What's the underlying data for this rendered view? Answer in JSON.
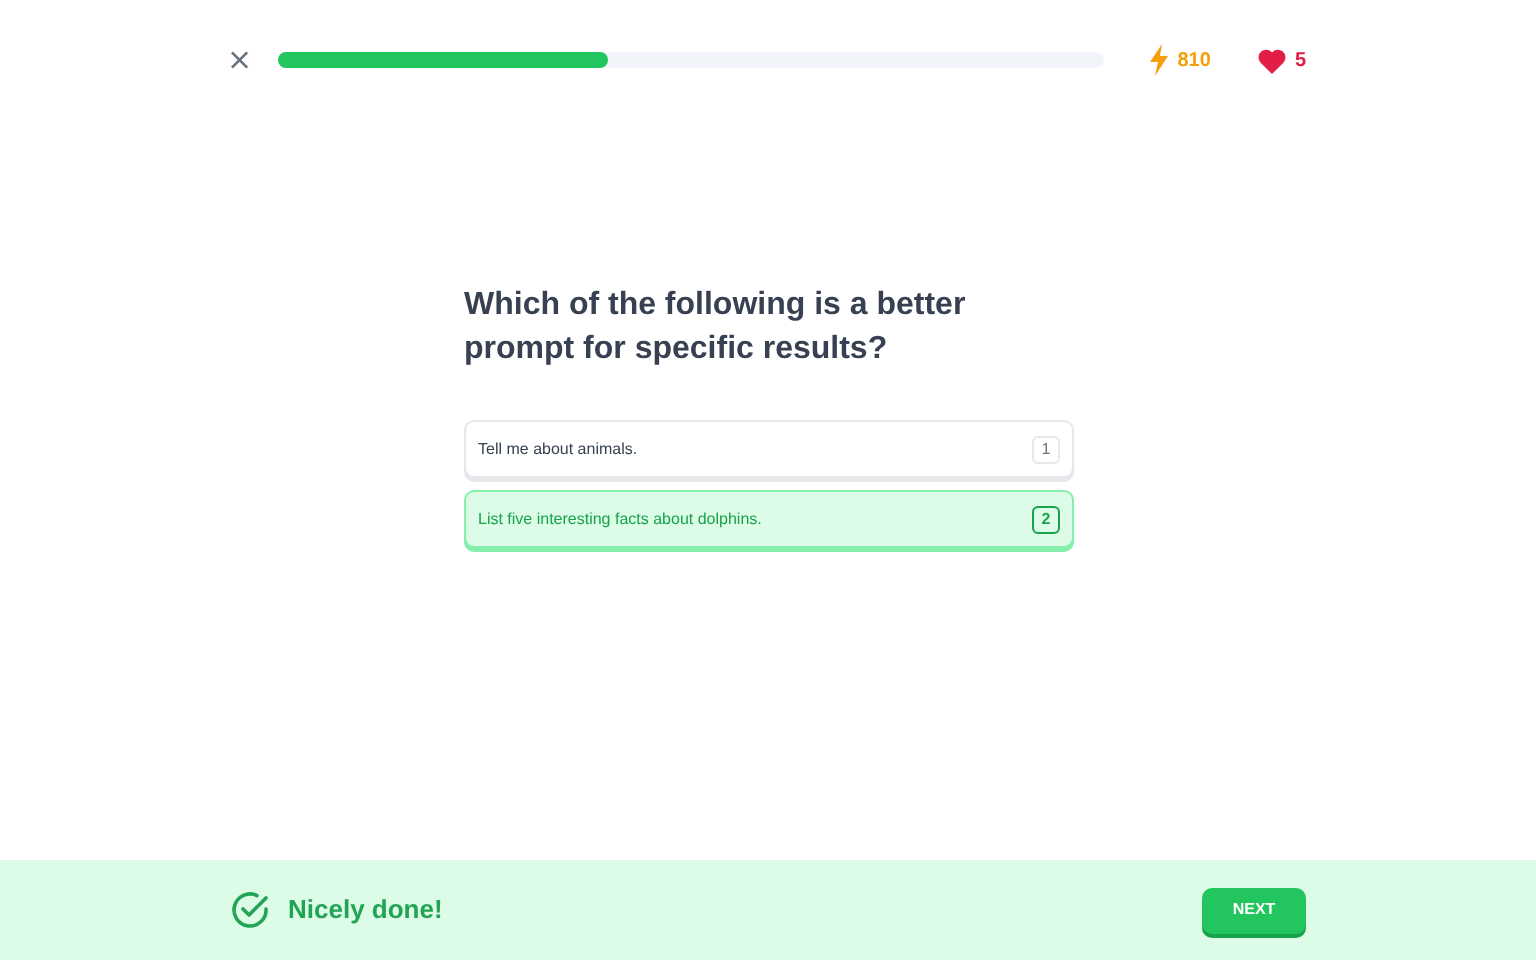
{
  "progress": {
    "level": 0.4
  },
  "stats": {
    "xp": "810",
    "hearts": "5"
  },
  "question": "Which of the following is a better prompt for specific results?",
  "options": [
    {
      "text": "Tell me about animals.",
      "key": "1",
      "selected": false
    },
    {
      "text": "List five interesting facts about dolphins.",
      "key": "2",
      "selected": true
    }
  ],
  "feedback": {
    "message": "Nicely done!",
    "button": "NEXT"
  }
}
